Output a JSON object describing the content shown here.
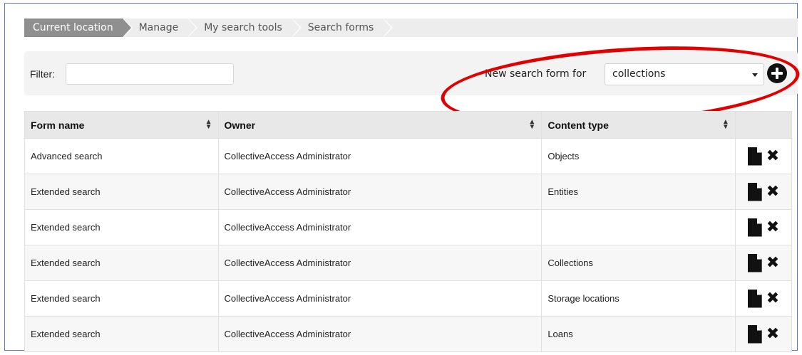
{
  "breadcrumb": {
    "items": [
      "Current location",
      "Manage",
      "My search tools",
      "Search forms"
    ]
  },
  "filter": {
    "label": "Filter:",
    "value": "",
    "placeholder": ""
  },
  "new_form": {
    "label": "New search form for",
    "selected": "collections",
    "add_icon": "plus-circle-icon"
  },
  "table": {
    "headers": [
      "Form name",
      "Owner",
      "Content type",
      ""
    ],
    "rows": [
      {
        "form_name": "Advanced search",
        "owner": "CollectiveAccess Administrator",
        "content_type": "Objects"
      },
      {
        "form_name": "Extended search",
        "owner": "CollectiveAccess Administrator",
        "content_type": "Entities"
      },
      {
        "form_name": "Extended search",
        "owner": "CollectiveAccess Administrator",
        "content_type": ""
      },
      {
        "form_name": "Extended search",
        "owner": "CollectiveAccess Administrator",
        "content_type": "Collections"
      },
      {
        "form_name": "Extended search",
        "owner": "CollectiveAccess Administrator",
        "content_type": "Storage locations"
      },
      {
        "form_name": "Extended search",
        "owner": "CollectiveAccess Administrator",
        "content_type": "Loans"
      }
    ],
    "row_action_icons": [
      "edit-document-icon",
      "delete-icon"
    ]
  },
  "colors": {
    "highlight": "#e00000",
    "breadcrumb_active": "#8f8f8f",
    "frame_border": "#5b7fb0"
  }
}
